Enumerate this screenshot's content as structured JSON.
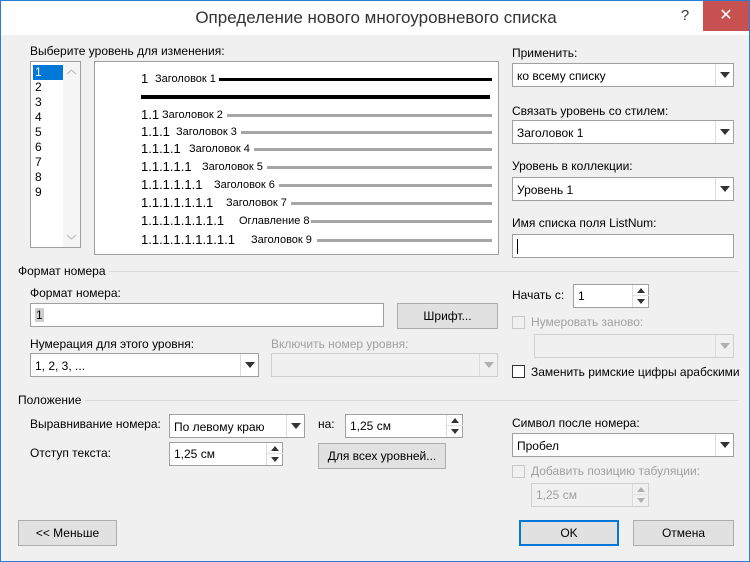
{
  "window": {
    "title": "Определение нового многоуровневого списка",
    "help": "?",
    "close": "✕"
  },
  "level_select": {
    "label": "Выберите уровень для изменения:",
    "items": [
      "1",
      "2",
      "3",
      "4",
      "5",
      "6",
      "7",
      "8",
      "9"
    ],
    "selected": "1"
  },
  "preview": {
    "rows": [
      {
        "num": "1",
        "name": "Заголовок 1"
      },
      {
        "num": "1.1",
        "name": "Заголовок 2"
      },
      {
        "num": "1.1.1",
        "name": "Заголовок 3"
      },
      {
        "num": "1.1.1.1",
        "name": "Заголовок 4"
      },
      {
        "num": "1.1.1.1.1",
        "name": "Заголовок 5"
      },
      {
        "num": "1.1.1.1.1.1",
        "name": "Заголовок 6"
      },
      {
        "num": "1.1.1.1.1.1.1",
        "name": "Заголовок 7"
      },
      {
        "num": "1.1.1.1.1.1.1.1",
        "name": "Оглавление 8"
      },
      {
        "num": "1.1.1.1.1.1.1.1.1",
        "name": "Заголовок 9"
      }
    ]
  },
  "right_panel": {
    "apply_label": "Применить:",
    "apply_value": "ко всему списку",
    "link_style_label": "Связать уровень со стилем:",
    "link_style_value": "Заголовок 1",
    "gallery_level_label": "Уровень в коллекции:",
    "gallery_level_value": "Уровень 1",
    "listnum_label": "Имя списка поля ListNum:",
    "listnum_value": ""
  },
  "number_format": {
    "section": "Формат номера",
    "format_label": "Формат номера:",
    "format_value": "1",
    "font_button": "Шрифт...",
    "numbering_style_label": "Нумерация для этого уровня:",
    "numbering_style_value": "1, 2, 3, ...",
    "include_level_label": "Включить номер уровня:",
    "include_level_value": "",
    "start_at_label": "Начать с:",
    "start_at_value": "1",
    "restart_label": "Нумеровать заново:",
    "restart_value": "",
    "legal_label": "Заменить римские цифры арабскими"
  },
  "position": {
    "section": "Положение",
    "alignment_label": "Выравнивание номера:",
    "alignment_value": "По левому краю",
    "at_label": "на:",
    "at_value": "1,25 см",
    "indent_label": "Отступ текста:",
    "indent_value": "1,25 см",
    "all_levels_button": "Для всех уровней...",
    "follow_label": "Символ после номера:",
    "follow_value": "Пробел",
    "tab_stop_label": "Добавить позицию табуляции:",
    "tab_stop_value": "1,25 см"
  },
  "footer": {
    "less_button": "<< Меньше",
    "ok_button": "OK",
    "cancel_button": "Отмена"
  }
}
